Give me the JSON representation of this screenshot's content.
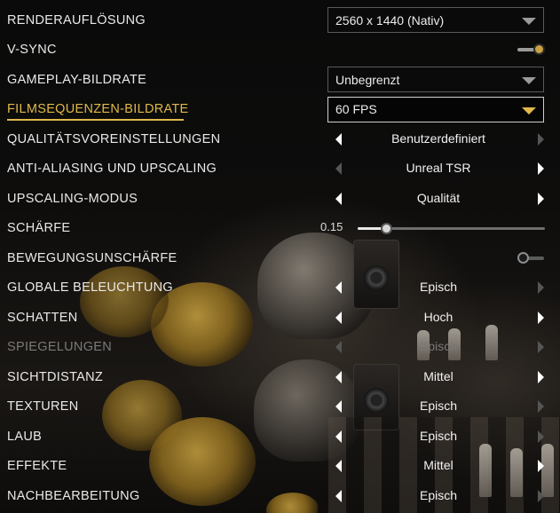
{
  "settings": {
    "render_resolution": {
      "label": "RENDERAUFLÖSUNG",
      "value": "2560 x 1440 (Nativ)"
    },
    "vsync": {
      "label": "V-SYNC",
      "state": "on"
    },
    "gameplay_framerate": {
      "label": "GAMEPLAY-BILDRATE",
      "value": "Unbegrenzt"
    },
    "cutscene_framerate": {
      "label": "FILMSEQUENZEN-BILDRATE",
      "value": "60 FPS",
      "active": true
    },
    "quality_preset": {
      "label": "QUALITÄTSVOREINSTELLUNGEN",
      "value": "Benutzerdefiniert"
    },
    "anti_aliasing": {
      "label": "ANTI-ALIASING UND UPSCALING",
      "value": "Unreal TSR"
    },
    "upscaling_mode": {
      "label": "UPSCALING-MODUS",
      "value": "Qualität"
    },
    "sharpness": {
      "label": "SCHÄRFE",
      "value_text": "0.15",
      "value": 0.15,
      "min": 0,
      "max": 1
    },
    "motion_blur": {
      "label": "BEWEGUNGSUNSCHÄRFE",
      "state": "off"
    },
    "global_illumination": {
      "label": "GLOBALE BELEUCHTUNG",
      "value": "Episch"
    },
    "shadows": {
      "label": "SCHATTEN",
      "value": "Hoch"
    },
    "reflections": {
      "label": "SPIEGELUNGEN",
      "value": "Episch",
      "disabled": true
    },
    "view_distance": {
      "label": "SICHTDISTANZ",
      "value": "Mittel"
    },
    "textures": {
      "label": "TEXTUREN",
      "value": "Episch"
    },
    "foliage": {
      "label": "LAUB",
      "value": "Episch"
    },
    "effects": {
      "label": "EFFEKTE",
      "value": "Mittel"
    },
    "post_processing": {
      "label": "NACHBEARBEITUNG",
      "value": "Episch"
    }
  },
  "colors": {
    "accent": "#e0b94a",
    "text": "#e9e9e9",
    "disabled": "#7a7a7a"
  },
  "icons": {
    "dropdown": "chevron-down-icon",
    "selector_prev": "arrow-left-icon",
    "selector_next": "arrow-right-icon"
  }
}
